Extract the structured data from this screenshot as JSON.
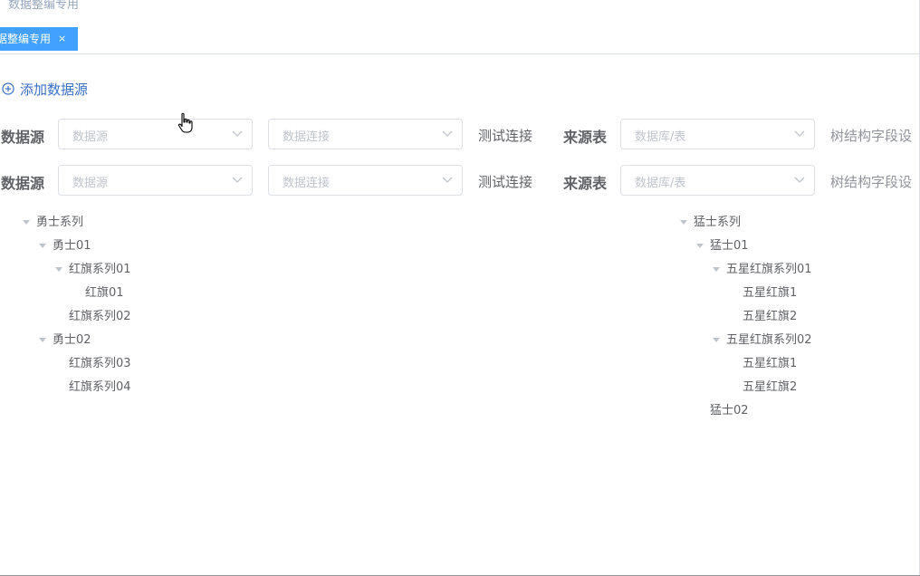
{
  "breadcrumb": {
    "text": "数据整编专用"
  },
  "tags": {
    "active_label": "据整编专用",
    "close_glyph": "×"
  },
  "add_source": {
    "label": "添加数据源"
  },
  "rows": [
    {
      "label": "数据源",
      "datasource_placeholder": "数据源",
      "connection_placeholder": "数据连接",
      "test_connection": "测试连接",
      "source_table_label": "来源表",
      "table_placeholder": "数据库/表",
      "tree_config": "树结构字段设"
    },
    {
      "label": "数据源",
      "datasource_placeholder": "数据源",
      "connection_placeholder": "数据连接",
      "test_connection": "测试连接",
      "source_table_label": "来源表",
      "table_placeholder": "数据库/表",
      "tree_config": "树结构字段设"
    }
  ],
  "left_tree": [
    {
      "label": "勇士系列",
      "level": 0,
      "expanded": true
    },
    {
      "label": "勇士01",
      "level": 1,
      "expanded": true
    },
    {
      "label": "红旗系列01",
      "level": 2,
      "expanded": true
    },
    {
      "label": "红旗01",
      "level": 3,
      "expanded": null
    },
    {
      "label": "红旗系列02",
      "level": 2,
      "expanded": null
    },
    {
      "label": "勇士02",
      "level": 1,
      "expanded": true
    },
    {
      "label": "红旗系列03",
      "level": 2,
      "expanded": null
    },
    {
      "label": "红旗系列04",
      "level": 2,
      "expanded": null
    }
  ],
  "right_tree": [
    {
      "label": "猛士系列",
      "level": 0,
      "expanded": true
    },
    {
      "label": "猛士01",
      "level": 1,
      "expanded": true
    },
    {
      "label": "五星红旗系列01",
      "level": 2,
      "expanded": true
    },
    {
      "label": "五星红旗1",
      "level": 3,
      "expanded": null
    },
    {
      "label": "五星红旗2",
      "level": 3,
      "expanded": null
    },
    {
      "label": "五星红旗系列02",
      "level": 2,
      "expanded": true
    },
    {
      "label": "五星红旗1",
      "level": 3,
      "expanded": null
    },
    {
      "label": "五星红旗2",
      "level": 3,
      "expanded": null
    },
    {
      "label": "猛士02",
      "level": 1,
      "expanded": null
    }
  ],
  "colors": {
    "accent": "#42a1ff",
    "link": "#3a6fc8",
    "placeholder": "#c0c4cc",
    "text": "#606266"
  },
  "icons": {
    "add": "plus-circle-icon",
    "dropdown": "chevron-down-icon",
    "expand": "caret-down-icon",
    "pointer": "hand-pointer-icon"
  }
}
